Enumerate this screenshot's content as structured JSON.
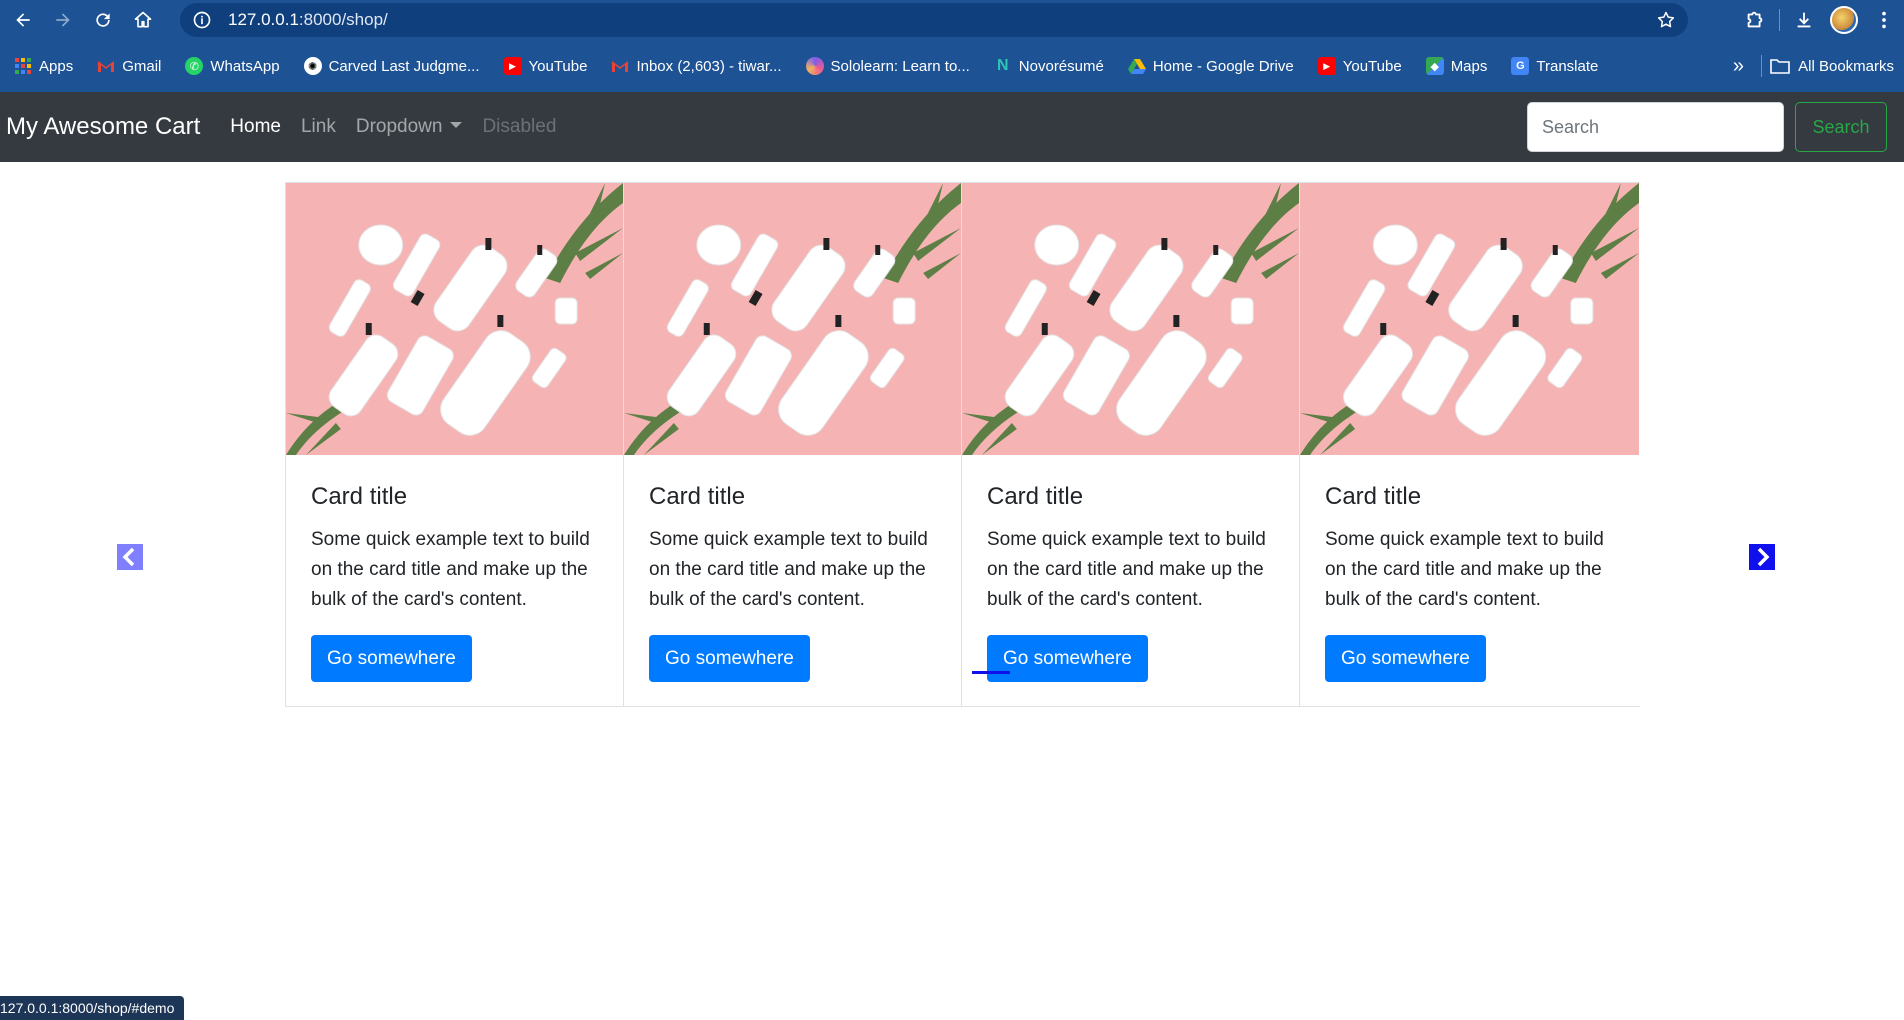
{
  "browser": {
    "url_host": "127.0.0.1",
    "url_rest": ":8000/shop/",
    "bookmarks": [
      {
        "label": "Apps",
        "icon": "apps-grid-icon",
        "color": "#e8453c"
      },
      {
        "label": "Gmail",
        "icon": "gmail-icon",
        "color": "#ea4335"
      },
      {
        "label": "WhatsApp",
        "icon": "whatsapp-icon",
        "color": "#25d366"
      },
      {
        "label": "Carved Last Judgme...",
        "icon": "chatgpt-icon",
        "color": "#000000"
      },
      {
        "label": "YouTube",
        "icon": "youtube-icon",
        "color": "#ff0000"
      },
      {
        "label": "Inbox (2,603) - tiwar...",
        "icon": "gmail-icon",
        "color": "#ea4335"
      },
      {
        "label": "Sololearn: Learn to...",
        "icon": "sololearn-icon",
        "color": "#7b5cf0"
      },
      {
        "label": "Novorésumé",
        "icon": "novoresume-icon",
        "color": "#2ec4b6"
      },
      {
        "label": "Home - Google Drive",
        "icon": "google-drive-icon",
        "color": "#fbbc04"
      },
      {
        "label": "YouTube",
        "icon": "youtube-icon",
        "color": "#ff0000"
      },
      {
        "label": "Maps",
        "icon": "google-maps-icon",
        "color": "#34a853"
      },
      {
        "label": "Translate",
        "icon": "google-translate-icon",
        "color": "#4285f4"
      }
    ],
    "all_bookmarks": "All Bookmarks",
    "status_url": "127.0.0.1:8000/shop/#demo"
  },
  "site": {
    "brand": "My Awesome Cart",
    "nav": {
      "home": "Home",
      "link": "Link",
      "dropdown": "Dropdown",
      "disabled": "Disabled"
    },
    "search": {
      "placeholder": "Search",
      "button": "Search"
    },
    "colors": {
      "navbar_bg": "#343a40",
      "primary": "#007bff",
      "success": "#28a745"
    }
  },
  "cards": [
    {
      "title": "Card title",
      "text": "Some quick example text to build on the card title and make up the bulk of the card's content.",
      "button": "Go somewhere"
    },
    {
      "title": "Card title",
      "text": "Some quick example text to build on the card title and make up the bulk of the card's content.",
      "button": "Go somewhere"
    },
    {
      "title": "Card title",
      "text": "Some quick example text to build on the card title and make up the bulk of the card's content.",
      "button": "Go somewhere"
    },
    {
      "title": "Card title",
      "text": "Some quick example text to build on the card title and make up the bulk of the card's content.",
      "button": "Go somewhere"
    }
  ]
}
